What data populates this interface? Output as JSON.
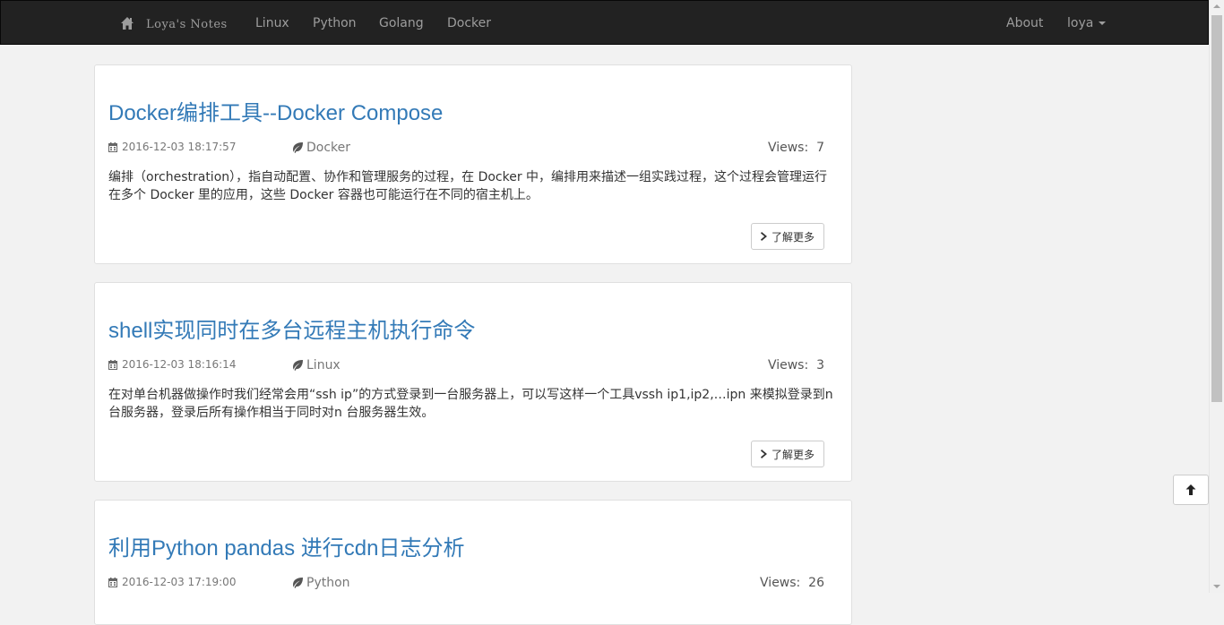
{
  "navbar": {
    "brand": "Loya's Notes",
    "links": [
      "Linux",
      "Python",
      "Golang",
      "Docker"
    ],
    "about": "About",
    "user": "loya"
  },
  "posts": [
    {
      "title": "Docker编排工具--Docker Compose",
      "date": "2016-12-03 18:17:57",
      "category": "Docker",
      "views_label": "Views:",
      "views": "7",
      "summary": "编排（orchestration），指自动配置、协作和管理服务的过程，在 Docker 中，编排用来描述一组实践过程，这个过程会管理运行在多个 Docker 里的应用，这些 Docker 容器也可能运行在不同的宿主机上。",
      "more": "了解更多"
    },
    {
      "title": "shell实现同时在多台远程主机执行命令",
      "date": "2016-12-03 18:16:14",
      "category": "Linux",
      "views_label": "Views:",
      "views": "3",
      "summary": "在对单台机器做操作时我们经常会用“ssh ip”的方式登录到一台服务器上，可以写这样一个工具vssh ip1,ip2,…ipn 来模拟登录到n 台服务器，登录后所有操作相当于同时对n 台服务器生效。",
      "more": "了解更多"
    },
    {
      "title": "利用Python pandas 进行cdn日志分析",
      "date": "2016-12-03 17:19:00",
      "category": "Python",
      "views_label": "Views:",
      "views": "26"
    }
  ]
}
